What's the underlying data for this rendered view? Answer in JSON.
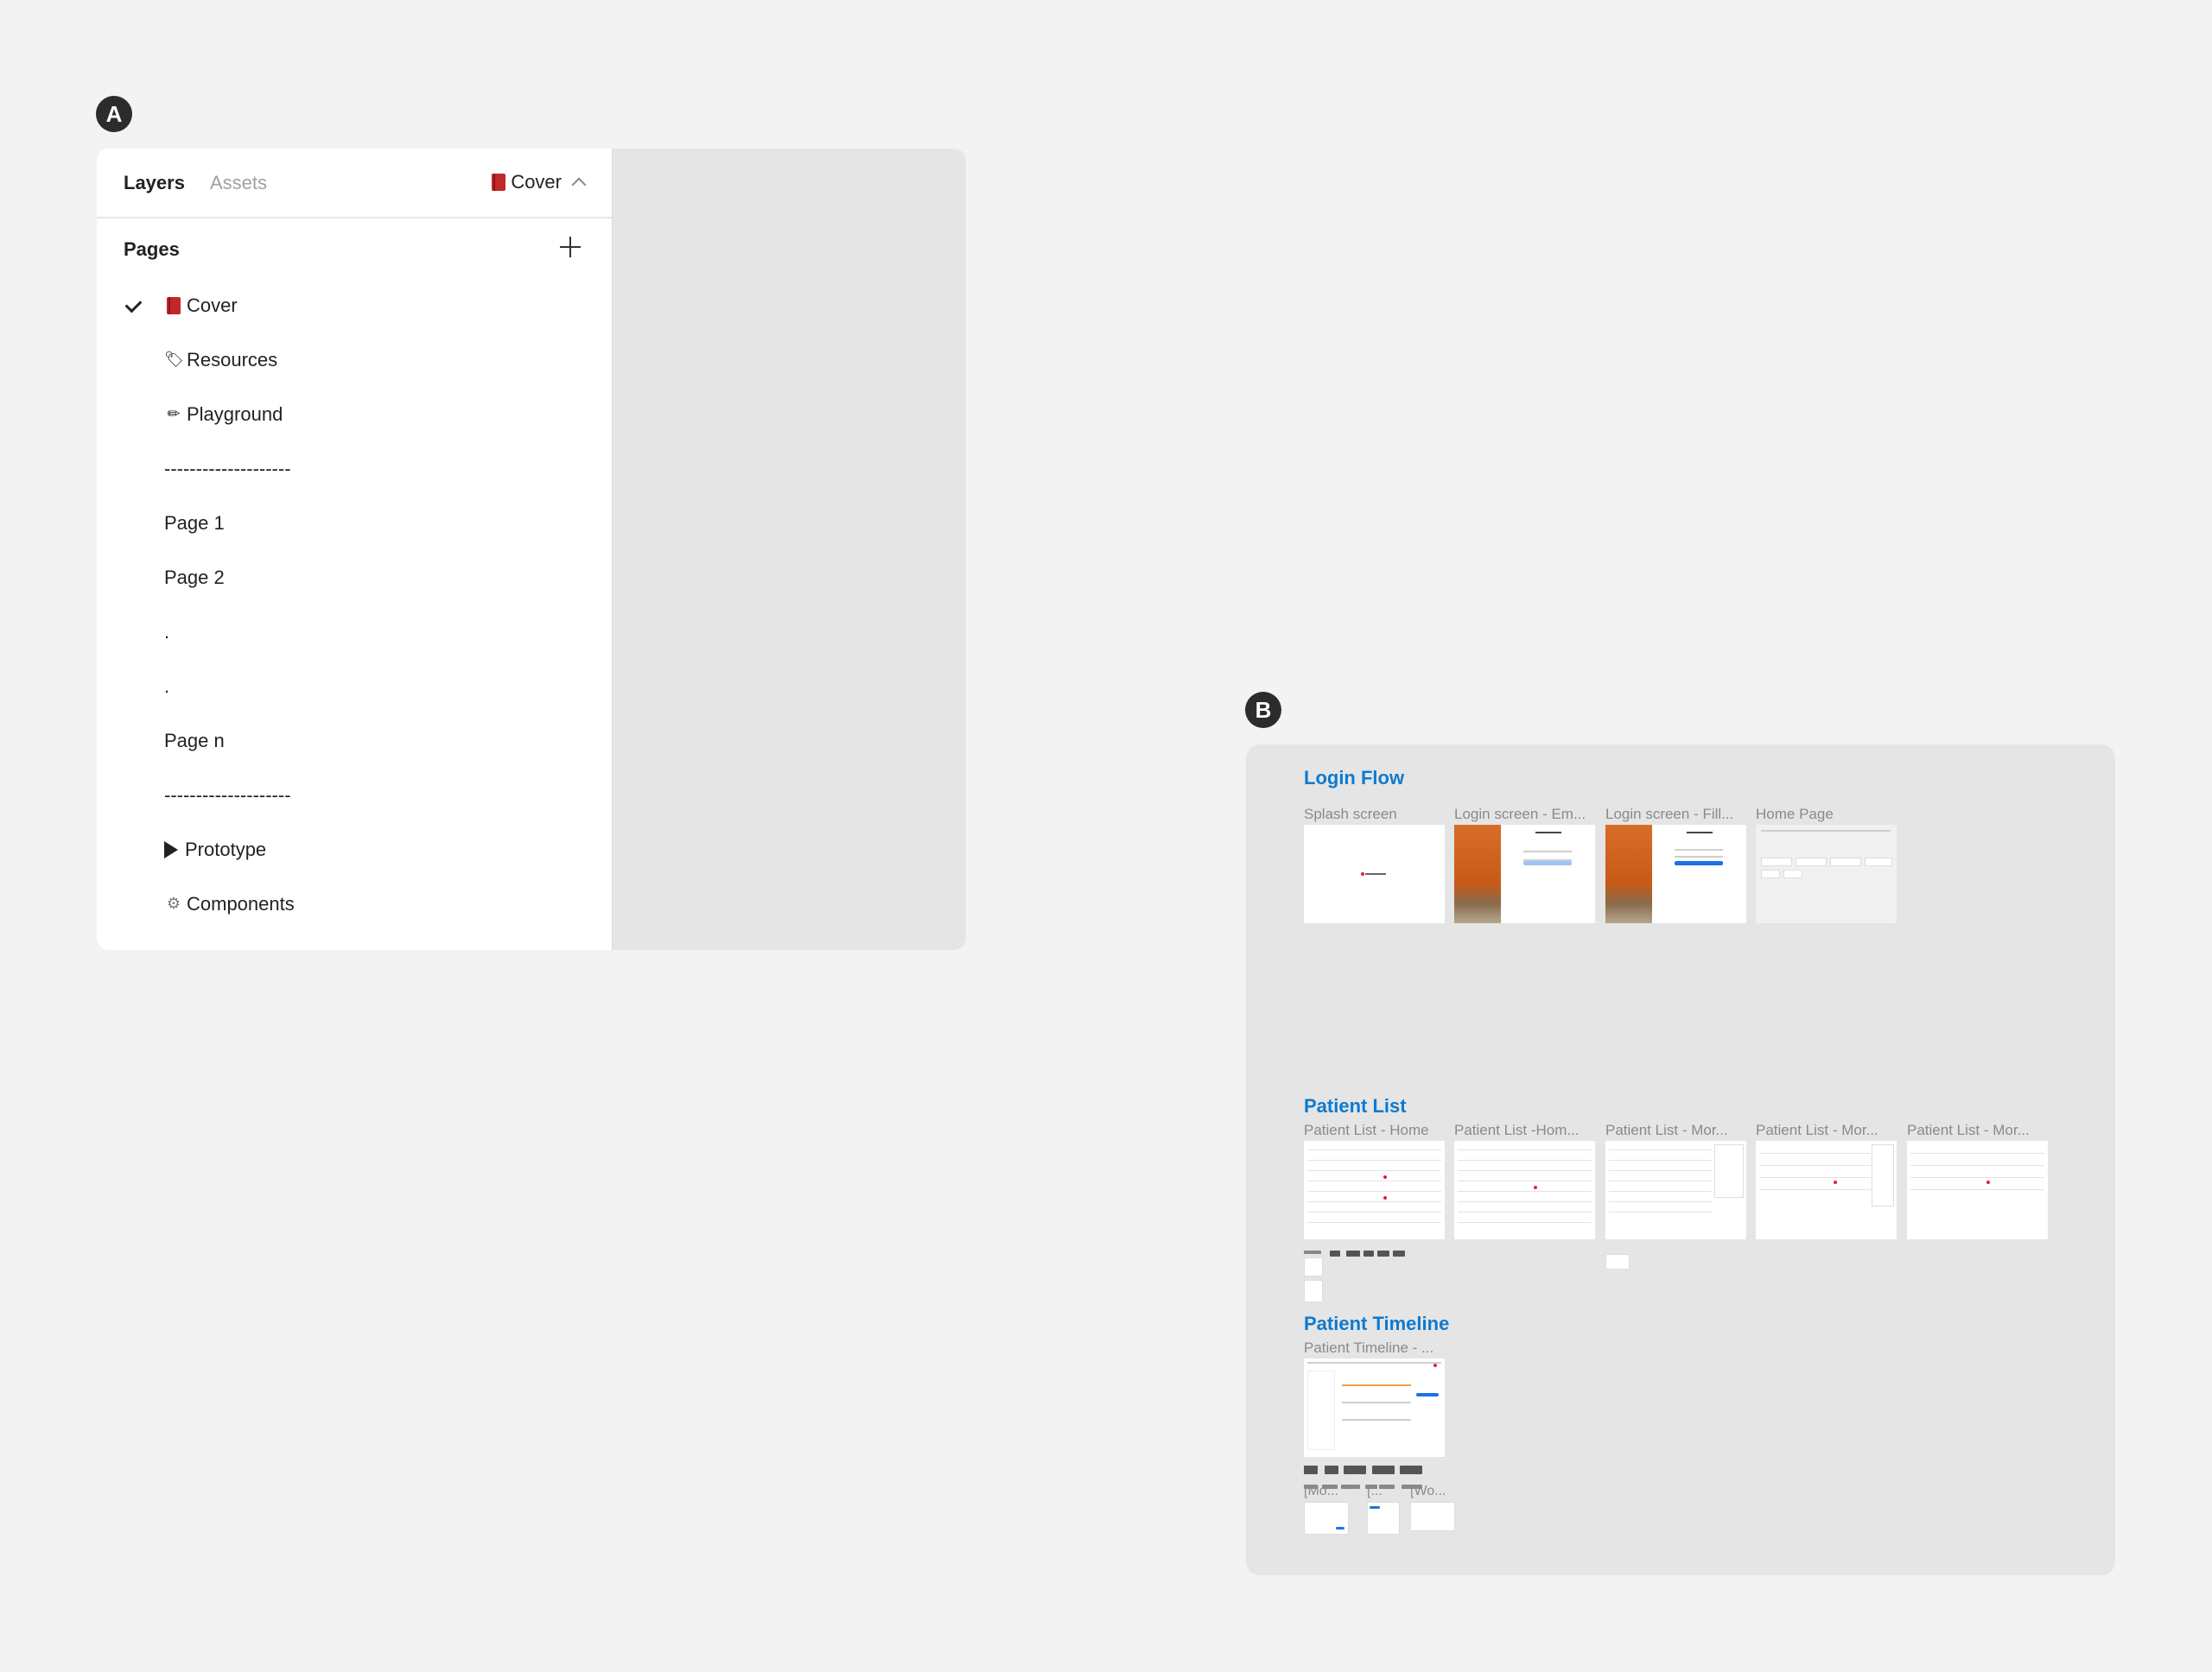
{
  "badges": {
    "a": "A",
    "b": "B"
  },
  "layers_panel": {
    "tabs": {
      "layers": "Layers",
      "assets": "Assets"
    },
    "current_page": "Cover",
    "pages_heading": "Pages",
    "pages": [
      {
        "label": "Cover",
        "icon": "book-icon",
        "selected": true
      },
      {
        "label": "Resources",
        "icon": "tag-icon"
      },
      {
        "label": "Playground",
        "icon": "pencil-icon"
      },
      {
        "label": "--------------------"
      },
      {
        "label": "Page 1"
      },
      {
        "label": "Page 2"
      },
      {
        "label": "."
      },
      {
        "label": "."
      },
      {
        "label": "Page n"
      },
      {
        "label": "--------------------"
      },
      {
        "label": "Prototype",
        "icon": "play-triangle-icon"
      },
      {
        "label": "Components",
        "icon": "gear-icon"
      }
    ]
  },
  "canvas": {
    "sections": {
      "login_flow": {
        "title": "Login Flow",
        "frames": [
          "Splash screen",
          "Login screen - Em...",
          "Login screen - Fill...",
          "Home Page"
        ]
      },
      "patient_list": {
        "title": "Patient List",
        "frames": [
          "Patient List - Home",
          "Patient List -Hom...",
          "Patient List - Mor...",
          "Patient List - Mor...",
          "Patient List - Mor..."
        ]
      },
      "patient_timeline": {
        "title": "Patient Timeline",
        "frames": [
          "Patient Timeline - ..."
        ],
        "small_labels": [
          "[Mo...",
          "[...",
          "[Wo..."
        ]
      }
    }
  },
  "colors": {
    "accent": "#0d7ad1",
    "badge": "#2c2c2c",
    "canvas": "#e5e5e5",
    "background": "#f3f3f3"
  }
}
